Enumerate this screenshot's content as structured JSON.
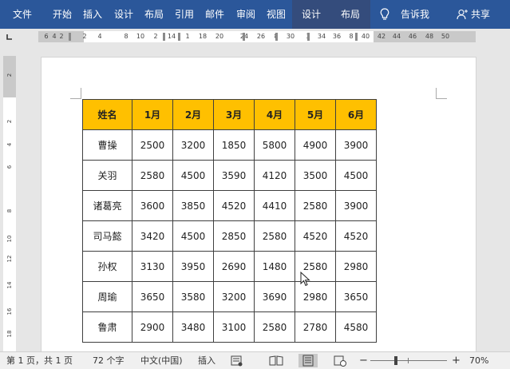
{
  "ribbon": {
    "tabs": [
      "文件",
      "开始",
      "插入",
      "设计",
      "布局",
      "引用",
      "邮件",
      "审阅",
      "视图"
    ],
    "context_tabs": [
      "设计",
      "布局"
    ],
    "tell_me": "告诉我",
    "share": "共享",
    "colors": {
      "ribbon": "#2b579a",
      "context_tab": "#344c7c"
    }
  },
  "ruler": {
    "horizontal": [
      "6",
      "4",
      "2",
      "2",
      "4",
      "8",
      "10",
      "2",
      "14",
      "1",
      "18",
      "20",
      "24",
      "26",
      "8",
      "30",
      "3",
      "34",
      "36",
      "8",
      "40",
      "42",
      "44",
      "46",
      "48",
      "50"
    ],
    "vertical": [
      "2",
      "2",
      "4",
      "6",
      "8",
      "10",
      "12",
      "14",
      "16",
      "18",
      "20",
      "22"
    ]
  },
  "table": {
    "headers": [
      "姓名",
      "1月",
      "2月",
      "3月",
      "4月",
      "5月",
      "6月"
    ],
    "header_color": "#ffc000",
    "rows": [
      [
        "曹操",
        "2500",
        "3200",
        "1850",
        "5800",
        "4900",
        "3900"
      ],
      [
        "关羽",
        "2580",
        "4500",
        "3590",
        "4120",
        "3500",
        "4500"
      ],
      [
        "诸葛亮",
        "3600",
        "3850",
        "4520",
        "4410",
        "2580",
        "3900"
      ],
      [
        "司马懿",
        "3420",
        "4500",
        "2850",
        "2580",
        "4520",
        "4520"
      ],
      [
        "孙权",
        "3130",
        "3950",
        "2690",
        "1480",
        "2580",
        "2980"
      ],
      [
        "周瑜",
        "3650",
        "3580",
        "3200",
        "3690",
        "2980",
        "3650"
      ],
      [
        "鲁肃",
        "2900",
        "3480",
        "3100",
        "2580",
        "2780",
        "4580"
      ]
    ]
  },
  "status": {
    "page": "第 1 页，共 1 页",
    "words": "72 个字",
    "language": "中文(中国)",
    "mode": "插入",
    "zoom_minus": "−",
    "zoom_plus": "+",
    "zoom": "70%"
  }
}
